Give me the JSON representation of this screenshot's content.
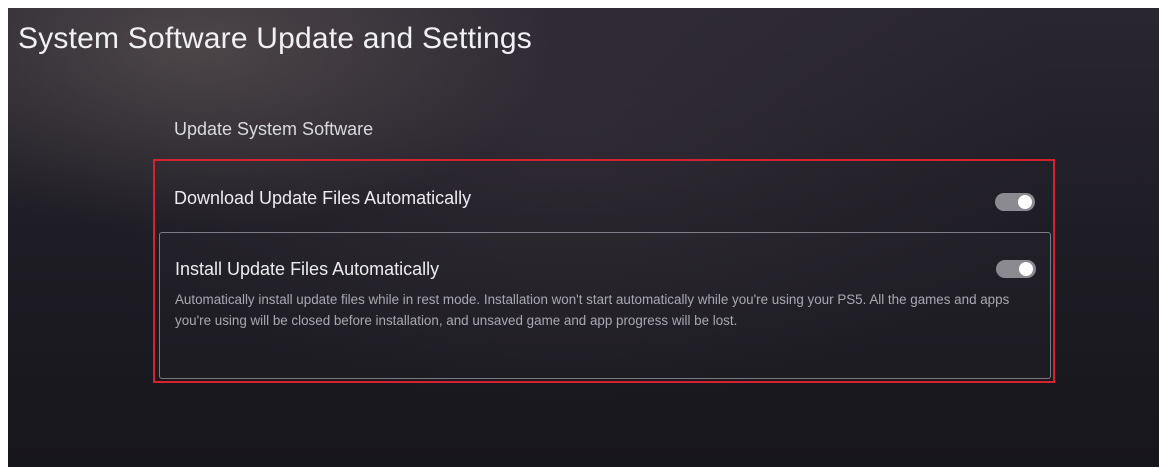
{
  "page": {
    "title": "System Software Update and Settings"
  },
  "section": {
    "heading": "Update System Software"
  },
  "settings": [
    {
      "label": "Download Update Files Automatically",
      "toggle_on": true
    },
    {
      "label": "Install Update Files Automatically",
      "description": "Automatically install update files while in rest mode. Installation won't start automatically while you're using your PS5. All the games and apps you're using will be closed before installation, and unsaved game and app progress will be lost.",
      "toggle_on": true
    }
  ],
  "colors": {
    "highlight_border": "#d6222f",
    "toggle_on_track": "#8a8a90"
  }
}
